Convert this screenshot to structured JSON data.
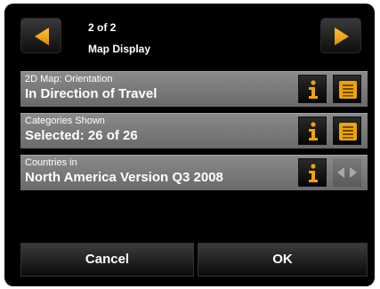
{
  "header": {
    "page_count": "2 of 2",
    "title": "Map Display"
  },
  "settings": [
    {
      "label": "2D Map: Orientation",
      "value": "In Direction of Travel",
      "info_icon": "info-icon",
      "action_icon": "list-icon"
    },
    {
      "label": "Categories Shown",
      "value": "Selected: 26 of 26",
      "info_icon": "info-icon",
      "action_icon": "list-icon"
    },
    {
      "label": "Countries in",
      "value": "North America Version Q3 2008",
      "info_icon": "info-icon",
      "action_icon": "left-right-arrows-icon"
    }
  ],
  "buttons": {
    "cancel": "Cancel",
    "ok": "OK"
  },
  "colors": {
    "accent": "#f0a300",
    "row_bg": "#7a7a7a",
    "background": "#000000"
  }
}
